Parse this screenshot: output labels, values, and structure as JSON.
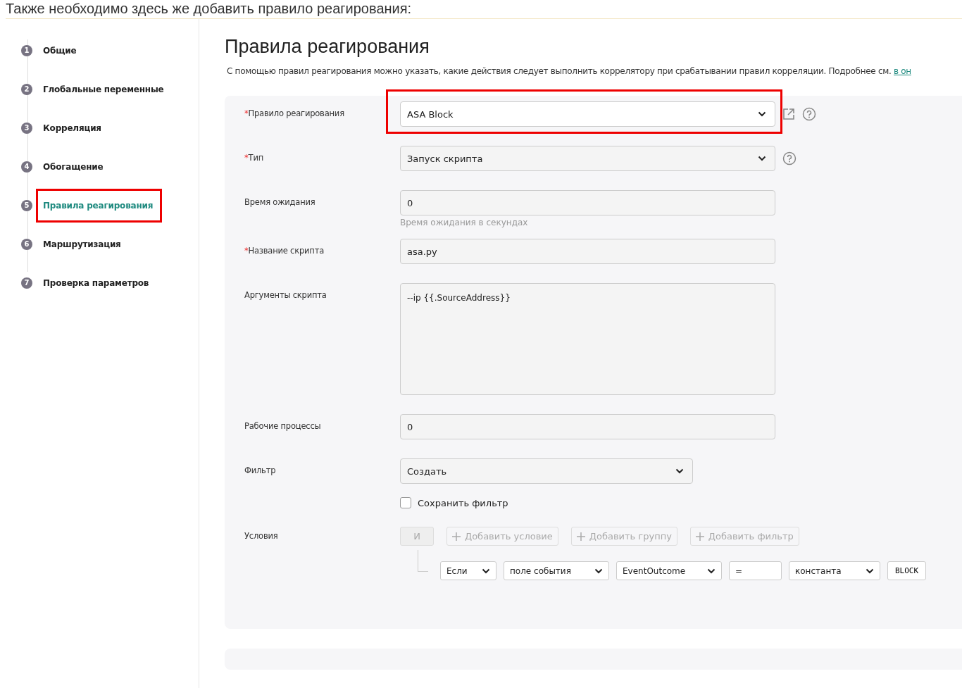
{
  "top_text": "Также необходимо здесь же добавить правило реагирования:",
  "steps": [
    {
      "number": "1",
      "label": "Общие",
      "selected": false,
      "highlighted": false
    },
    {
      "number": "2",
      "label": "Глобальные переменные",
      "selected": false,
      "highlighted": false
    },
    {
      "number": "3",
      "label": "Корреляция",
      "selected": false,
      "highlighted": false
    },
    {
      "number": "4",
      "label": "Обогащение",
      "selected": false,
      "highlighted": false
    },
    {
      "number": "5",
      "label": "Правила реагирования",
      "selected": true,
      "highlighted": true
    },
    {
      "number": "6",
      "label": "Маршрутизация",
      "selected": false,
      "highlighted": false
    },
    {
      "number": "7",
      "label": "Проверка параметров",
      "selected": false,
      "highlighted": false
    }
  ],
  "title": "Правила реагирования",
  "description": {
    "text": "С помощью правил реагирования можно указать, какие действия следует выполнить коррелятору при срабатывании правил корреляции. Подробнее см.",
    "link": "в он"
  },
  "fields": [
    {
      "kind": "select",
      "label": "Правило реагирования",
      "required_mark": "*",
      "value": "ASA Block",
      "highlighted": true,
      "external_link": true,
      "help": true,
      "wide": true
    },
    {
      "kind": "select",
      "label": "Тип",
      "required_mark": "*",
      "value": "Запуск скрипта",
      "highlighted": false,
      "external_link": false,
      "help": true,
      "wide": true
    },
    {
      "kind": "input",
      "label": "Время ожидания",
      "value": "0",
      "hint": "Время ожидания в секундах"
    },
    {
      "kind": "input",
      "label": "Название скрипта",
      "required_mark": "*",
      "value": "asa.py"
    },
    {
      "kind": "textarea",
      "label": "Аргументы скрипта",
      "value": "--ip {{.SourceAddress}}"
    },
    {
      "kind": "input",
      "label": "Рабочие процессы",
      "value": "0"
    },
    {
      "kind": "select",
      "label": "Фильтр",
      "value": "Создать",
      "highlighted": false,
      "external_link": false,
      "help": false,
      "wide": false
    },
    {
      "kind": "checkbox",
      "label": "Сохранить фильтр",
      "checked": false
    }
  ],
  "conditions": {
    "label": "Условия",
    "operator": "И",
    "buttons": [
      "Добавить условие",
      "Добавить группу",
      "Добавить фильтр"
    ],
    "row": [
      {
        "kind": "select",
        "value": "Если"
      },
      {
        "kind": "select",
        "value": "поле события"
      },
      {
        "kind": "select",
        "value": "EventOutcome"
      },
      {
        "kind": "input",
        "value": "="
      },
      {
        "kind": "select",
        "value": "константа"
      },
      {
        "kind": "button",
        "value": "BLOCK"
      }
    ]
  }
}
